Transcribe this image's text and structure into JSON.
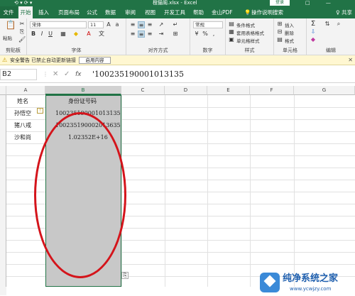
{
  "titlebar": {
    "quick_access": "⟲ ▾ ⟳ ▾",
    "doc_title": "橙猫阁.xlsx - Excel",
    "login": "登录",
    "window_controls": "□ — □ ✕"
  },
  "tabs": [
    "文件",
    "开始",
    "插入",
    "页面布局",
    "公式",
    "数据",
    "审阅",
    "视图",
    "开发工具",
    "帮助",
    "金山PDF",
    "操作说明搜索"
  ],
  "share": "♀ 共享",
  "ribbon": {
    "clipboard": {
      "paste": "粘贴",
      "label": "剪贴板"
    },
    "font": {
      "name": "宋体",
      "size": "11",
      "bold": "B",
      "italic": "I",
      "underline": "U",
      "label": "字体"
    },
    "alignment": {
      "label": "对齐方式"
    },
    "number": {
      "format": "常规",
      "percent": "%",
      "comma": ",",
      "label": "数字"
    },
    "styles": {
      "conditional": "条件格式",
      "table": "套用表格格式",
      "cell": "单元格样式",
      "label": "样式"
    },
    "cells": {
      "insert": "插入",
      "delete": "删除",
      "format": "格式",
      "label": "单元格"
    },
    "editing": {
      "sum": "Σ",
      "fill": "⇩",
      "clear": "◆",
      "label": "编辑"
    }
  },
  "security_bar": {
    "title": "安全警告",
    "message": "已禁止自动更新链接",
    "enable_button": "启用内容",
    "close": "✕"
  },
  "formula_bar": {
    "name_box": "B2",
    "formula": "'100235190001013135"
  },
  "sheet": {
    "columns": [
      "A",
      "B",
      "C",
      "D",
      "E",
      "F",
      "G"
    ],
    "cells": {
      "A1": "姓名",
      "B1": "身份证号码",
      "A2": "孙悟空",
      "B2": "100235190001013135",
      "A3": "猪八戒",
      "B3": "100235190002013635",
      "A4": "沙和尚",
      "B4": "1.02352E+16"
    }
  },
  "watermark": {
    "name": "纯净系统之家",
    "url": "www.ycwjzy.com"
  }
}
